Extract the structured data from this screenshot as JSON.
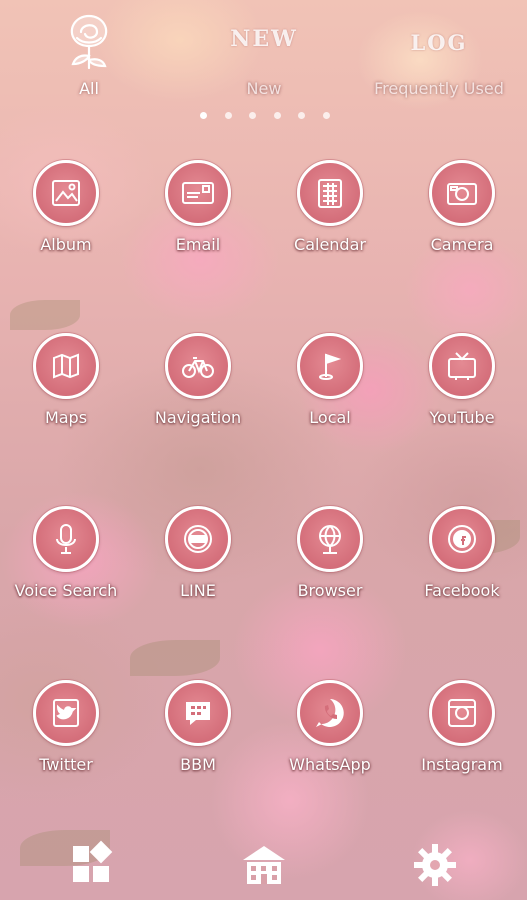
{
  "tabs": [
    {
      "label": "All",
      "emblem": "rose-icon",
      "active": true
    },
    {
      "label": "New",
      "emblem_text": "NEW",
      "active": false
    },
    {
      "label": "Frequently Used",
      "emblem_text": "LOG",
      "active": false
    }
  ],
  "page_indicator": {
    "count": 6,
    "current": 1
  },
  "apps": [
    {
      "label": "Album",
      "icon": "picture-frame-icon"
    },
    {
      "label": "Email",
      "icon": "envelope-icon"
    },
    {
      "label": "Calendar",
      "icon": "calendar-icon"
    },
    {
      "label": "Camera",
      "icon": "camera-icon"
    },
    {
      "label": "Maps",
      "icon": "map-icon"
    },
    {
      "label": "Navigation",
      "icon": "bicycle-icon"
    },
    {
      "label": "Local",
      "icon": "flag-pin-icon"
    },
    {
      "label": "YouTube",
      "icon": "tv-icon"
    },
    {
      "label": "Voice Search",
      "icon": "microphone-icon"
    },
    {
      "label": "LINE",
      "icon": "line-badge-icon"
    },
    {
      "label": "Browser",
      "icon": "globe-icon"
    },
    {
      "label": "Facebook",
      "icon": "facebook-badge-icon"
    },
    {
      "label": "Twitter",
      "icon": "bird-frame-icon"
    },
    {
      "label": "BBM",
      "icon": "chat-bubble-icon"
    },
    {
      "label": "WhatsApp",
      "icon": "phone-bubble-icon"
    },
    {
      "label": "Instagram",
      "icon": "instagram-camera-icon"
    }
  ],
  "dock": [
    {
      "icon": "app-drawer-icon"
    },
    {
      "icon": "house-icon"
    },
    {
      "icon": "settings-gear-icon"
    }
  ],
  "colors": {
    "icon_fill": "#d46e7a",
    "icon_border": "#ffffff",
    "label_text": "#ffffff"
  }
}
